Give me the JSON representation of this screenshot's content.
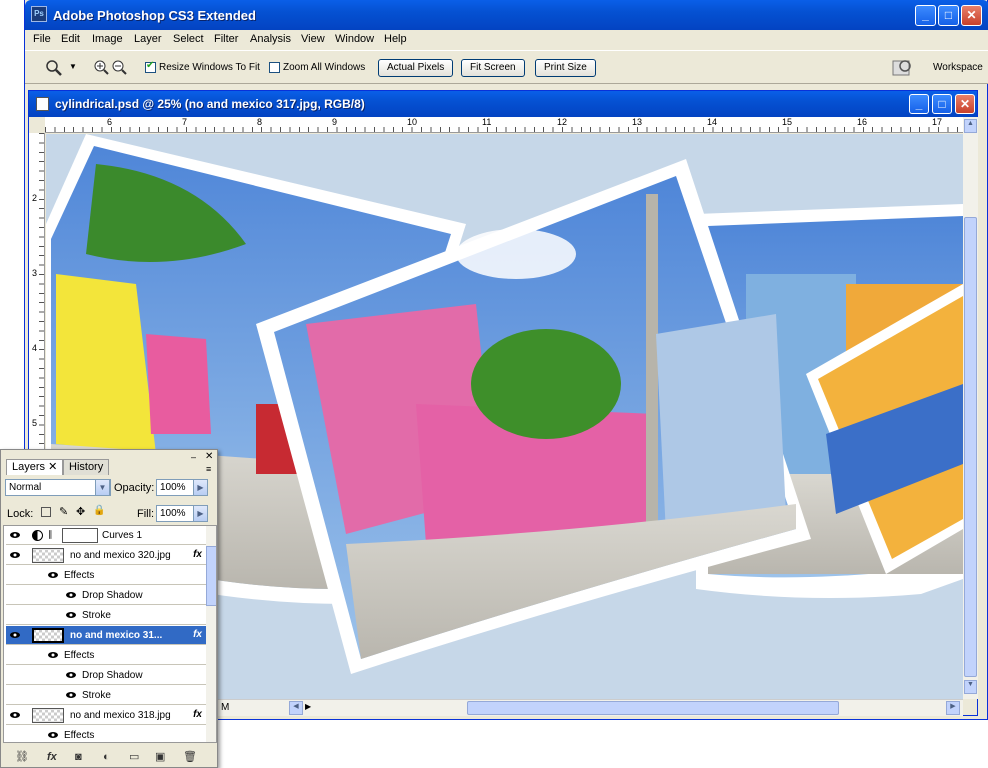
{
  "app": {
    "title": "Adobe Photoshop CS3 Extended",
    "logo": "Ps"
  },
  "menu": [
    "File",
    "Edit",
    "Image",
    "Layer",
    "Select",
    "Filter",
    "Analysis",
    "View",
    "Window",
    "Help"
  ],
  "options": {
    "resize_windows": {
      "label": "Resize Windows To Fit",
      "checked": true
    },
    "zoom_all": {
      "label": "Zoom All Windows",
      "checked": false
    },
    "actual_pixels": "Actual Pixels",
    "fit_screen": "Fit Screen",
    "print_size": "Print Size",
    "workspace": "Workspace"
  },
  "document": {
    "title": "cylindrical.psd @ 25% (no and mexico 317.jpg, RGB/8)",
    "ruler_top": [
      "6",
      "7",
      "8",
      "9",
      "10",
      "11",
      "12",
      "13",
      "14",
      "15",
      "16",
      "17"
    ],
    "ruler_left": [
      "2",
      "3",
      "4",
      "5"
    ],
    "status_suffix": "M"
  },
  "layers_panel": {
    "tabs": [
      "Layers",
      "History"
    ],
    "blend_mode": "Normal",
    "opacity_label": "Opacity:",
    "opacity": "100%",
    "lock_label": "Lock:",
    "fill_label": "Fill:",
    "fill": "100%",
    "rows": [
      {
        "name": "Curves 1",
        "type": "adjustment"
      },
      {
        "name": "no and mexico 320.jpg",
        "type": "layer",
        "fx": true
      },
      {
        "name": "Effects",
        "type": "effects"
      },
      {
        "name": "Drop Shadow",
        "type": "effect"
      },
      {
        "name": "Stroke",
        "type": "effect"
      },
      {
        "name": "no and mexico 31...",
        "type": "layer",
        "fx": true,
        "selected": true
      },
      {
        "name": "Effects",
        "type": "effects"
      },
      {
        "name": "Drop Shadow",
        "type": "effect"
      },
      {
        "name": "Stroke",
        "type": "effect"
      },
      {
        "name": "no and mexico 318.jpg",
        "type": "layer",
        "fx": true
      },
      {
        "name": "Effects",
        "type": "effects"
      }
    ],
    "fx_label": "fx"
  }
}
